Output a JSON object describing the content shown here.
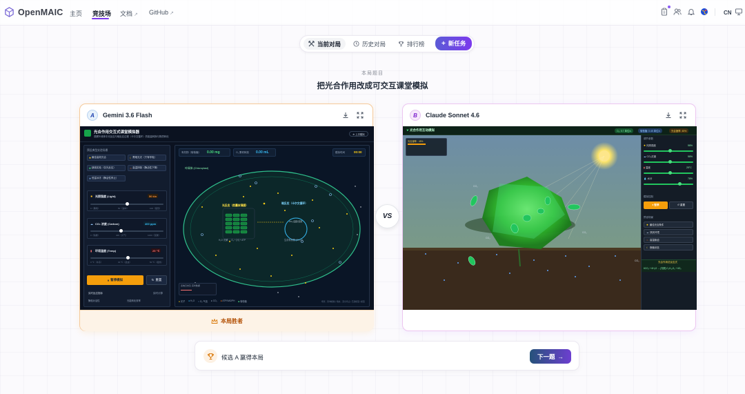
{
  "nav": {
    "brand": "OpenMAIC",
    "links": [
      "主页",
      "竞技场",
      "文档",
      "GitHub"
    ],
    "lang": "CN"
  },
  "tabs": {
    "current": "当前对局",
    "history": "历史对局",
    "leaderboard": "排行榜",
    "new_task": "新任务"
  },
  "header": {
    "subtitle": "本局题目",
    "title": "把光合作用改成可交互课堂模拟"
  },
  "card_a": {
    "badge": "A",
    "model": "Gemini 3.6 Flash",
    "winner_label": "本局胜者",
    "sim": {
      "title": "光合作用交互式课堂模拟器",
      "desc": "观察叶绿体中光反应与暗反应过程（卡尔文循环）的能量转换与物质转化",
      "top_btn": "⊕ 上次模拟",
      "section": "预设典型实验场景",
      "presets": [
        "最佳高效光合",
        "黑暗无光（只有呼吸）",
        "缺碳实验（仅光反应）",
        "高温抑制（酶活性下降）",
        "低温冰冻（酶活性停止）"
      ],
      "stat1_label": "有机物（葡萄糖）",
      "stat1_value": "0.00 mg",
      "stat2_label": "O₂ 累积释放",
      "stat2_value": "0.00 mL",
      "stat3_label": "模拟时间",
      "stat3_value": "00:00",
      "light_label": "光照强度 (Light)",
      "light_value": "50 klx",
      "light_ticks": [
        "0（黑暗）",
        "50（适中）",
        "100（强烈）"
      ],
      "co2_label": "CO₂ 浓度 (Carbon)",
      "co2_value": "400 ppm",
      "co2_ticks": [
        "0（缺碳）",
        "400（大气）",
        "1000（富碳）"
      ],
      "temp_label": "环境温度 (Temp)",
      "temp_value": "25 ℃",
      "temp_ticks": [
        "0 ℃（冰冻）",
        "30 ℃（最适）",
        "50 ℃（极热）"
      ],
      "pause_btn": "暂停模拟",
      "reset_btn": "重置",
      "metrics_label": "实时反应指标",
      "metrics_right": "实时计算",
      "metrics_rows": [
        "酶相对活性",
        "光能转化效率"
      ],
      "chloroplast_label": "叶绿体 (Chloroplast)",
      "light_rxn": "光反应（类囊体薄膜）",
      "dark_rxn": "暗反应（卡尔文循环）",
      "dark_inner": "CO₂ 固定/还原",
      "eq_left": "H₂O 光解 → O₂ + [H] + ATP",
      "eq_right": "生成有机物 (CH₂O)",
      "legend": [
        "光子",
        "H₂O",
        "O₂ 气泡",
        "CO₂",
        "ATP/NADPH",
        "葡萄糖"
      ],
      "footer_right": "场景：影响模拟 | 暗态：完全停止 | 已建模型 | 模型",
      "log_label": "系统日志及 实时数据"
    }
  },
  "card_b": {
    "badge": "B",
    "model": "Claude Sonnet 4.6",
    "sim": {
      "title": "光合作用互动模拟",
      "top_stats": [
        "O₂: 0.7 单位/s",
        "葡萄糖: 0.45 单位/s",
        "光合速率: 45%"
      ],
      "rate_label": "光合速率：45%",
      "panel_title": "调节参数",
      "params": [
        {
          "label": "光照强度",
          "value": "58%"
        },
        {
          "label": "CO₂浓度",
          "value": "58%"
        },
        {
          "label": "温度",
          "value": "25°C"
        },
        {
          "label": "水分",
          "value": "78%"
        }
      ],
      "ctrl_title": "模拟控制",
      "pause": "⏸ 暂停",
      "reset": "↺ 重置",
      "scene_title": "预设场景",
      "scenes": [
        "最佳光合条件",
        "阴天环境",
        "高温胁迫",
        "夜晚状态"
      ],
      "formula_title": "光合作用总反应式",
      "formula": "6CO₂ + 6H₂O → (光照) C₆H₁₂O₆ + 6O₂"
    }
  },
  "vs": "VS",
  "footer": {
    "text": "候选 A 赢得本局",
    "next": "下一题"
  }
}
